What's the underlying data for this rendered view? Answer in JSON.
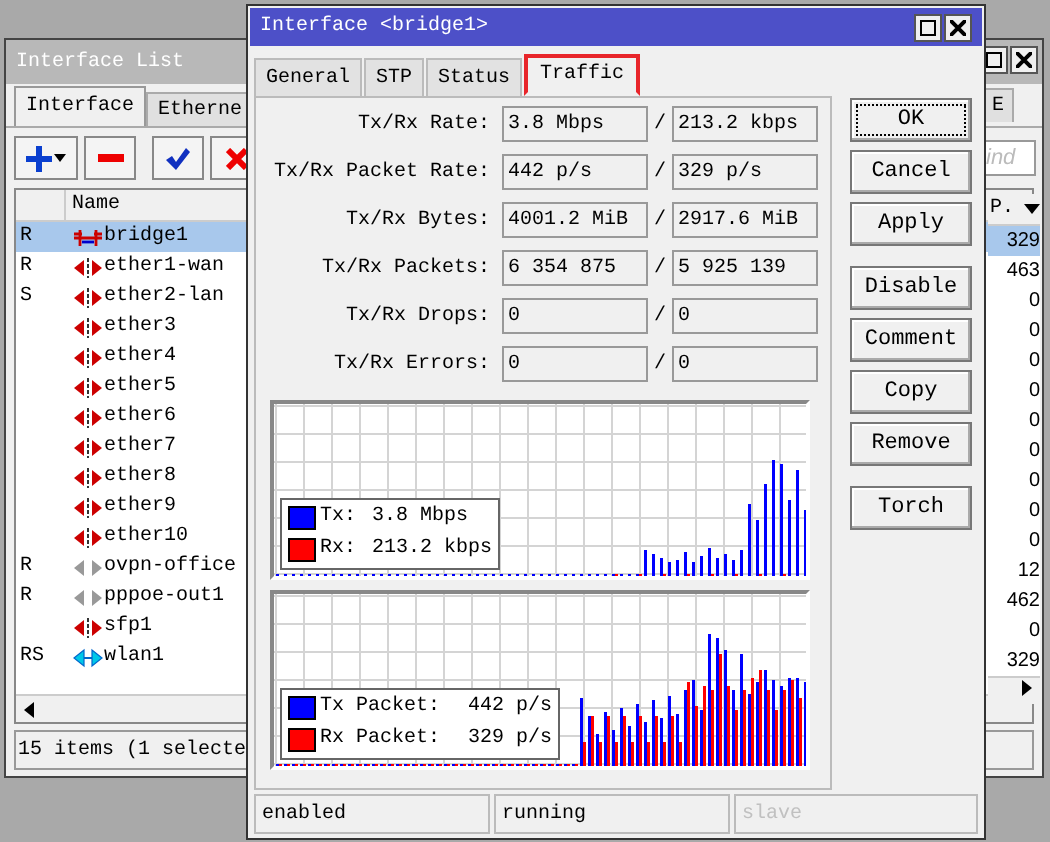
{
  "interface_list": {
    "title": "Interface List",
    "tabs": [
      {
        "label": "Interface",
        "selected": true
      },
      {
        "label": "Etherne",
        "selected": false
      },
      {
        "label": "E",
        "selected": false
      }
    ],
    "find": {
      "placeholder": "ind"
    },
    "columns": {
      "name": "Name",
      "value": "P."
    },
    "rows": [
      {
        "flag": "R",
        "kind": "bridge",
        "name": "bridge1",
        "value": "329",
        "selected": true
      },
      {
        "flag": "R",
        "kind": "ethernet",
        "name": "ether1-wan",
        "value": "463",
        "selected": false
      },
      {
        "flag": "S",
        "kind": "ethernet",
        "name": "ether2-lan",
        "value": "0",
        "selected": false
      },
      {
        "flag": "",
        "kind": "ethernet",
        "name": "ether3",
        "value": "0",
        "selected": false
      },
      {
        "flag": "",
        "kind": "ethernet",
        "name": "ether4",
        "value": "0",
        "selected": false
      },
      {
        "flag": "",
        "kind": "ethernet",
        "name": "ether5",
        "value": "0",
        "selected": false
      },
      {
        "flag": "",
        "kind": "ethernet",
        "name": "ether6",
        "value": "0",
        "selected": false
      },
      {
        "flag": "",
        "kind": "ethernet",
        "name": "ether7",
        "value": "0",
        "selected": false
      },
      {
        "flag": "",
        "kind": "ethernet",
        "name": "ether8",
        "value": "0",
        "selected": false
      },
      {
        "flag": "",
        "kind": "ethernet",
        "name": "ether9",
        "value": "0",
        "selected": false
      },
      {
        "flag": "",
        "kind": "ethernet",
        "name": "ether10",
        "value": "0",
        "selected": false
      },
      {
        "flag": "R",
        "kind": "tunnel",
        "name": "ovpn-office",
        "value": "12",
        "selected": false
      },
      {
        "flag": "R",
        "kind": "tunnel",
        "name": "pppoe-out1",
        "value": "462",
        "selected": false
      },
      {
        "flag": "",
        "kind": "ethernet",
        "name": "sfp1",
        "value": "0",
        "selected": false
      },
      {
        "flag": "RS",
        "kind": "wireless",
        "name": "wlan1",
        "value": "329",
        "selected": false
      }
    ],
    "status": "15 items (1 selecte"
  },
  "dialog": {
    "title": "Interface <bridge1>",
    "tabs": [
      {
        "label": "General",
        "selected": false
      },
      {
        "label": "STP",
        "selected": false
      },
      {
        "label": "Status",
        "selected": false
      },
      {
        "label": "Traffic",
        "selected": true
      }
    ],
    "fields": [
      {
        "label": "Tx/Rx Rate:",
        "tx": "3.8 Mbps",
        "rx": "213.2 kbps"
      },
      {
        "label": "Tx/Rx Packet Rate:",
        "tx": "442 p/s",
        "rx": "329 p/s"
      },
      {
        "label": "Tx/Rx Bytes:",
        "tx": "4001.2 MiB",
        "rx": "2917.6 MiB"
      },
      {
        "label": "Tx/Rx Packets:",
        "tx": "6 354 875",
        "rx": "5 925 139"
      },
      {
        "label": "Tx/Rx Drops:",
        "tx": "0",
        "rx": "0"
      },
      {
        "label": "Tx/Rx Errors:",
        "tx": "0",
        "rx": "0"
      }
    ],
    "separator": "/",
    "graphs": [
      {
        "kind": "rate",
        "legend": [
          {
            "label": "Tx:",
            "value": "3.8 Mbps",
            "color": "#0000ff"
          },
          {
            "label": "Rx:",
            "value": "213.2 kbps",
            "color": "#ff0000"
          }
        ]
      },
      {
        "kind": "packets",
        "legend": [
          {
            "label": "Tx Packet:",
            "value": "442 p/s",
            "color": "#0000ff"
          },
          {
            "label": "Rx Packet:",
            "value": "329 p/s",
            "color": "#ff0000"
          }
        ]
      }
    ],
    "button_groups": [
      [
        {
          "label": "OK",
          "default": true
        },
        {
          "label": "Cancel",
          "default": false
        },
        {
          "label": "Apply",
          "default": false
        }
      ],
      [
        {
          "label": "Disable",
          "default": false
        },
        {
          "label": "Comment",
          "default": false
        },
        {
          "label": "Copy",
          "default": false
        },
        {
          "label": "Remove",
          "default": false
        }
      ],
      [
        {
          "label": "Torch",
          "default": false
        }
      ]
    ],
    "status": [
      {
        "text": "enabled",
        "disabled": false
      },
      {
        "text": "running",
        "disabled": false
      },
      {
        "text": "slave",
        "disabled": true
      }
    ]
  }
}
